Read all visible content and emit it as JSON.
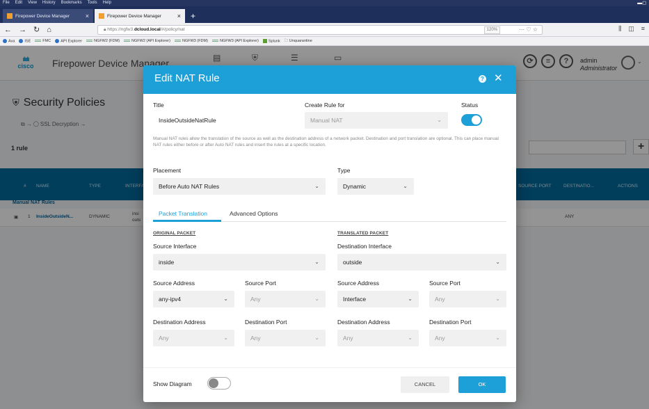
{
  "browser": {
    "menu": [
      "File",
      "Edit",
      "View",
      "History",
      "Bookmarks",
      "Tools",
      "Help"
    ],
    "tabs": [
      {
        "label": "Firepower Device Manager",
        "active": false
      },
      {
        "label": "Firepower Device Manager",
        "active": true
      }
    ],
    "url_prefix": "https://ngfw3.",
    "url_host": "dcloud.local",
    "url_path": "/#/policy/nat",
    "zoom": "120%",
    "url_extras": "··· ♡ ☆",
    "bookmarks": [
      "Ava",
      "ISE",
      "FMC",
      "API Explorer",
      "NGFW2 (FDM)",
      "NGFW2 (API Explorer)",
      "NGFW3 (FDM)",
      "NGFW3 (API Explorer)",
      "Splunk",
      "Unquarantine"
    ]
  },
  "app": {
    "logo_text": "cisco",
    "title": "Firepower Device Manager",
    "user_name": "admin",
    "user_role": "Administrator",
    "page_title": "Security Policies",
    "flow_text": "⧉ → ◯ SSL Decryption →",
    "rule_count": "1 rule",
    "table_headers": [
      "#",
      "NAME",
      "TYPE",
      "INTERFACES",
      "SOURCE PORT",
      "DESTINATIO...",
      "ACTIONS"
    ],
    "group_label": "Manual NAT Rules",
    "row": {
      "index": "1",
      "name": "InsideOutsideN...",
      "type": "DYNAMIC",
      "interface": "insi",
      "interface2": "outs",
      "dest": "ANY"
    }
  },
  "modal": {
    "title": "Edit NAT Rule",
    "help_icon": "?",
    "close_icon": "✕",
    "title_label": "Title",
    "title_value": "InsideOutsideNatRule",
    "create_rule_label": "Create Rule for",
    "create_rule_value": "Manual NAT",
    "status_label": "Status",
    "status_on": true,
    "note": "Manual NAT rules allow the translation of the source as well as the destination address of a network packet. Destination and port translation are optional. This can place manual NAT rules either before or after Auto NAT rules and insert the rules at a specific location.",
    "placement_label": "Placement",
    "placement_value": "Before Auto NAT Rules",
    "type_label": "Type",
    "type_value": "Dynamic",
    "tabs": [
      "Packet Translation",
      "Advanced Options"
    ],
    "original_packet_label": "ORIGINAL PACKET",
    "translated_packet_label": "TRANSLATED PACKET",
    "original": {
      "source_interface_label": "Source Interface",
      "source_interface_value": "inside",
      "source_address_label": "Source Address",
      "source_address_value": "any-ipv4",
      "source_port_label": "Source Port",
      "source_port_value": "Any",
      "destination_address_label": "Destination Address",
      "destination_address_value": "Any",
      "destination_port_label": "Destination Port",
      "destination_port_value": "Any"
    },
    "translated": {
      "destination_interface_label": "Destination Interface",
      "destination_interface_value": "outside",
      "source_address_label": "Source Address",
      "source_address_value": "Interface",
      "source_port_label": "Source Port",
      "source_port_value": "Any",
      "destination_address_label": "Destination Address",
      "destination_address_value": "Any",
      "destination_port_label": "Destination Port",
      "destination_port_value": "Any"
    },
    "show_diagram_label": "Show Diagram",
    "show_diagram_on": false,
    "cancel_label": "CANCEL",
    "ok_label": "OK"
  },
  "colors": {
    "accent": "#1d9fd8",
    "table_header": "#006b9f",
    "browser_chrome": "#1f2f5b"
  }
}
